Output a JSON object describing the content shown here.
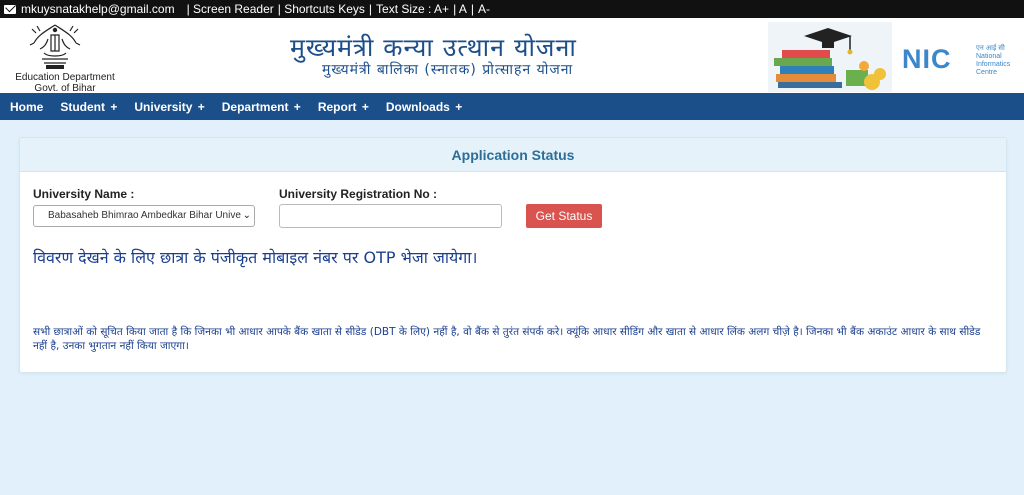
{
  "topbar": {
    "email": "mkuysnatakhelp@gmail.com",
    "links": [
      "| Screen Reader",
      "| Shortcuts Keys",
      "|",
      "Text Size : A+",
      "| A",
      "|",
      "A-"
    ]
  },
  "header": {
    "dept_line1": "Education Department",
    "dept_line2": "Govt. of Bihar",
    "title": "मुख्यमंत्री कन्या उत्थान योजना",
    "subtitle": "मुख्यमंत्री बालिका (स्नातक) प्रोत्साहन योजना",
    "nic_logo": "NIC",
    "nic_hindi": "एन आई सी",
    "nic_english": [
      "National",
      "Informatics",
      "Centre"
    ]
  },
  "nav": {
    "items": [
      {
        "label": "Home",
        "plus": ""
      },
      {
        "label": "Student",
        "plus": "+"
      },
      {
        "label": "University",
        "plus": "+"
      },
      {
        "label": "Department",
        "plus": "+"
      },
      {
        "label": "Report",
        "plus": "+"
      },
      {
        "label": "Downloads",
        "plus": "+"
      }
    ]
  },
  "panel": {
    "title": "Application Status",
    "university_label": "University Name :",
    "university_value": "Babasaheb Bhimrao Ambedkar Bihar Universi",
    "regno_label": "University Registration No :",
    "regno_value": "",
    "button_label": "Get Status",
    "otp_message": "विवरण देखने के लिए छात्रा के पंजीकृत मोबाइल नंबर पर OTP भेजा जायेगा।",
    "notice": "सभी छात्राओं को सूचित किया जाता है कि जिनका भी आधार आपके बैंक खाता से सीडेड (DBT के लिए) नहीं है, वो बैंक से तुरंत संपर्क करे। क्यूंकि आधार सीडिंग और खाता से आधार लिंक अलग चीज़े है। जिनका भी बैंक अकाउंट आधार के साथ सीडेड नहीं है, उनका भुगतान नहीं किया जाएगा।"
  },
  "colors": {
    "topbar": "#111111",
    "navbar": "#1b4f8a",
    "page_bg": "#e1f0fa",
    "button": "#d9534f",
    "heading": "#2c6e97",
    "hindi_text": "#1b3f8f"
  },
  "icons": [
    "mail-icon",
    "bihar-emblem-icon",
    "books-graduation-icon",
    "nic-logo"
  ]
}
